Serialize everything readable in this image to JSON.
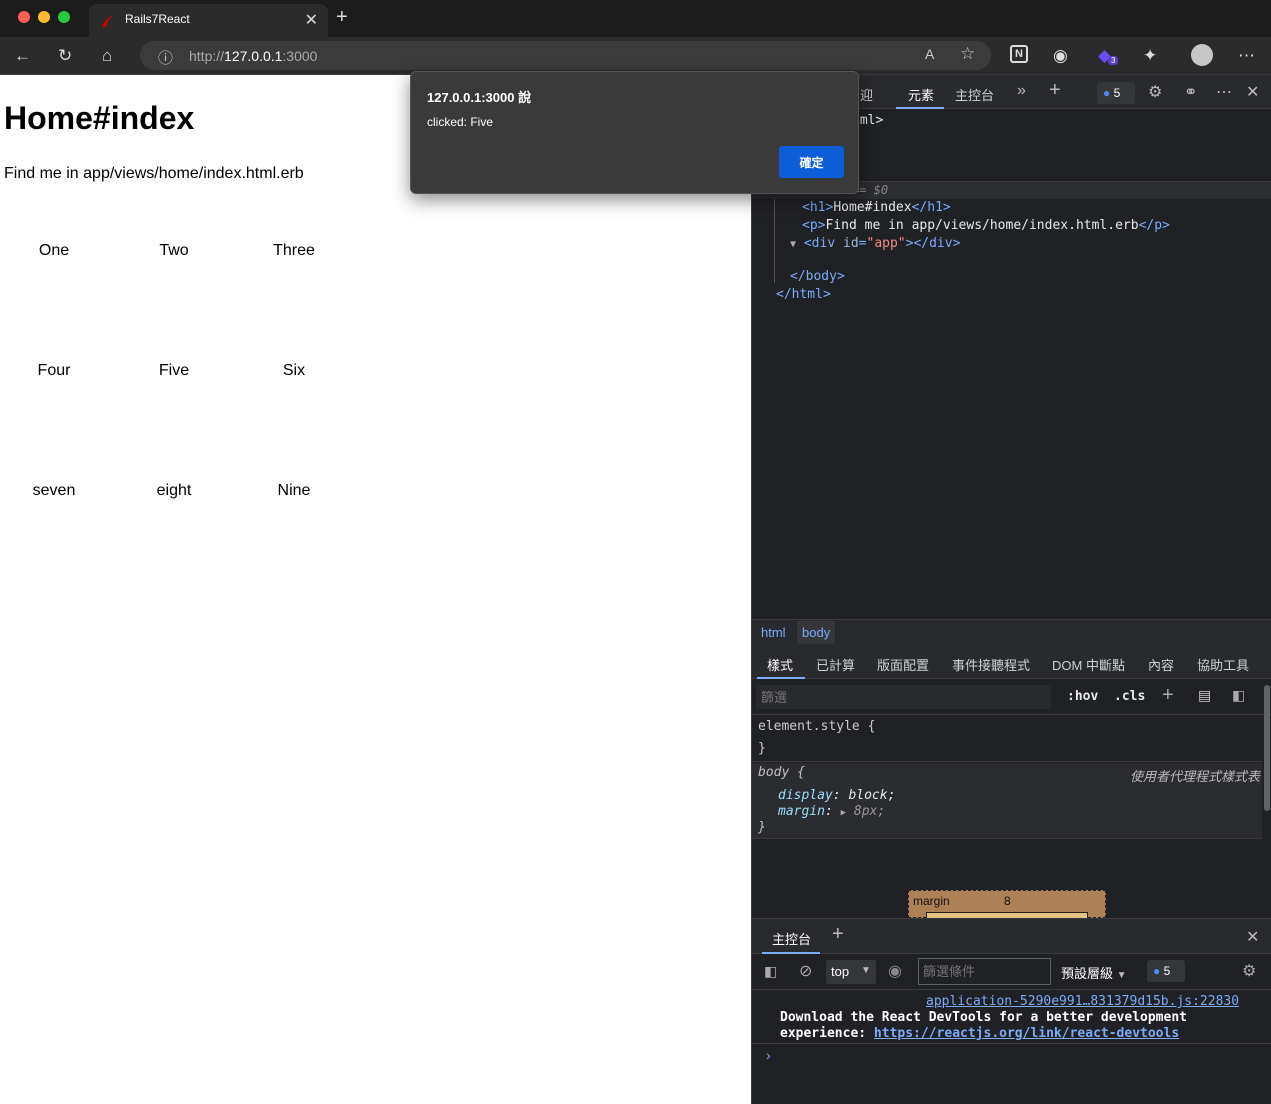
{
  "browser": {
    "tab_title": "Rails7React",
    "url_prefix": "http://",
    "url_host": "127.0.0.1",
    "url_port": ":3000",
    "extension_badge": "3"
  },
  "page": {
    "heading": "Home#index",
    "paragraph": "Find me in app/views/home/index.html.erb",
    "grid": [
      [
        "One",
        "Two",
        "Three"
      ],
      [
        "Four",
        "Five",
        "Six"
      ],
      [
        "seven",
        "eight",
        "Nine"
      ]
    ]
  },
  "alert": {
    "title": "127.0.0.1:3000 說",
    "message": "clicked: Five",
    "ok_label": "確定"
  },
  "devtools": {
    "tabs": {
      "welcome_fragment": "迎",
      "elements": "元素",
      "console": "主控台"
    },
    "issues_count": "5",
    "dom": {
      "html_fragment": "tml>",
      "selected_marker": "== $0",
      "h1_text": "Home#index",
      "p_text": "Find me in app/views/home/index.html.erb",
      "div_id": "app"
    },
    "breadcrumb": [
      "html",
      "body"
    ],
    "sub_tabs": [
      "樣式",
      "已計算",
      "版面配置",
      "事件接聽程式",
      "DOM 中斷點",
      "內容",
      "協助工具"
    ],
    "filter_placeholder": "篩選",
    "hov": ":hov",
    "cls": ".cls",
    "styles": {
      "element_style": "element.style {",
      "close_brace": "}",
      "body_selector": "body {",
      "user_agent_label": "使用者代理程式樣式表",
      "display_prop": "display",
      "display_val": "block;",
      "margin_prop": "margin",
      "margin_val": "8px;"
    },
    "box_model": {
      "label": "margin",
      "value": "8"
    },
    "drawer": {
      "tab": "主控台",
      "context": "top",
      "filter_placeholder": "篩選條件",
      "levels": "預設層級",
      "issues_count": "5"
    },
    "console": {
      "source_link": "application-5290e991…831379d15b.js:22830",
      "message_line1": "Download the React DevTools for a better development",
      "message_line2": "experience: ",
      "message_link": "https://reactjs.org/link/react-devtools",
      "prompt": "›"
    }
  }
}
